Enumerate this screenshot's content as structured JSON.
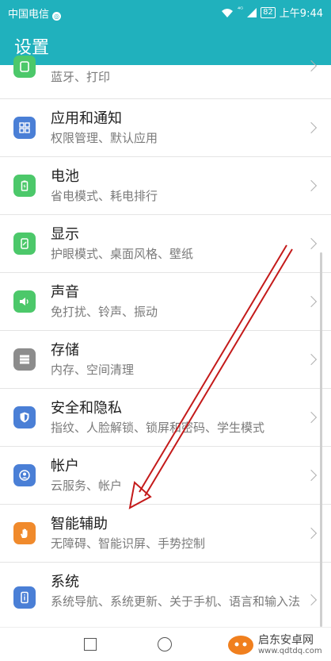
{
  "status_bar": {
    "carrier": "中国电信",
    "carrier_badge": "◎",
    "network": "⁴ᴳ",
    "battery": "82",
    "time": "上午9:44"
  },
  "header": {
    "title": "设置"
  },
  "settings": [
    {
      "key": "bluetooth",
      "title": "",
      "subtitle": "蓝牙、打印",
      "icon": "device-connection-icon",
      "color": "#4cc86a"
    },
    {
      "key": "apps",
      "title": "应用和通知",
      "subtitle": "权限管理、默认应用",
      "icon": "apps-grid-icon",
      "color": "#4a7fd6"
    },
    {
      "key": "battery",
      "title": "电池",
      "subtitle": "省电模式、耗电排行",
      "icon": "battery-icon",
      "color": "#4cc86a"
    },
    {
      "key": "display",
      "title": "显示",
      "subtitle": "护眼模式、桌面风格、壁纸",
      "icon": "display-icon",
      "color": "#4cc86a"
    },
    {
      "key": "sound",
      "title": "声音",
      "subtitle": "免打扰、铃声、振动",
      "icon": "speaker-icon",
      "color": "#4cc86a"
    },
    {
      "key": "storage",
      "title": "存储",
      "subtitle": "内存、空间清理",
      "icon": "storage-icon",
      "color": "#8c8c8c"
    },
    {
      "key": "security",
      "title": "安全和隐私",
      "subtitle": "指纹、人脸解锁、锁屏和密码、学生模式",
      "icon": "shield-icon",
      "color": "#4a7fd6"
    },
    {
      "key": "account",
      "title": "帐户",
      "subtitle": "云服务、帐户",
      "icon": "account-icon",
      "color": "#4a7fd6"
    },
    {
      "key": "assist",
      "title": "智能辅助",
      "subtitle": "无障碍、智能识屏、手势控制",
      "icon": "hand-icon",
      "color": "#f08a2c"
    },
    {
      "key": "system",
      "title": "系统",
      "subtitle": "系统导航、系统更新、关于手机、语言和输入法",
      "icon": "system-info-icon",
      "color": "#4a7fd6"
    }
  ],
  "watermark": {
    "text": "启东安卓网",
    "url": "www.qdtdq.com"
  }
}
